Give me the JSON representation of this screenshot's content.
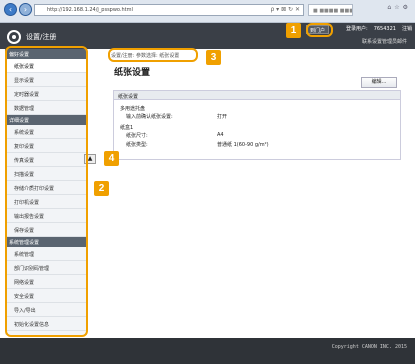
{
  "browser": {
    "url": "http://192.168.1.24/j_psspwo.html",
    "tabs": [
      "■ ■■■■ ■■■■■",
      "■ ■■■■■ ■■■■■"
    ],
    "window_controls": "☆ ⚙"
  },
  "header": {
    "title": "设置/注册",
    "portal_button": "到门户",
    "login_user_label": "登录用户:",
    "login_user_value": "7654321",
    "logout": "注销",
    "mail_link": "联系设置管理员邮件"
  },
  "sidebar": {
    "sections": [
      {
        "head": "偏好设置",
        "items": [
          "纸张设置",
          "显示设置",
          "定时器设置",
          "数据管理"
        ]
      },
      {
        "head": "详细设置",
        "items": [
          "系统设置",
          "复印设置",
          "传真设置",
          "扫描设置",
          "存储介质打印设置",
          "打印机设置",
          "输出报告设置",
          "保存设置"
        ]
      },
      {
        "head": "系统管理设置",
        "items": [
          "系统管理",
          "部门识别码管理",
          "网络设置",
          "安全设置",
          "导入/导出",
          "初始化设置信息"
        ]
      }
    ]
  },
  "main": {
    "breadcrumb": "设置/注册: 参数选择: 纸张设置",
    "title": "纸张设置",
    "edit_button": "编辑...",
    "section_head": "纸张设置",
    "rows": {
      "r1": "多用途托盘",
      "r2_label": "输入前确认纸张设置:",
      "r2_value": "打开",
      "r3": "纸盒1",
      "r4_label": "纸张尺寸:",
      "r4_value": "A4",
      "r5_label": "纸张类型:",
      "r5_value": "普通纸 1(60-90 g/m²)"
    },
    "top_button": "▲"
  },
  "footer": {
    "copyright": "Copyright CANON INC. 2015"
  },
  "callouts": [
    "1",
    "2",
    "3",
    "4"
  ],
  "colors": {
    "callout": "#f0a000",
    "header": "#3a3f47",
    "footer": "#2f3338"
  }
}
